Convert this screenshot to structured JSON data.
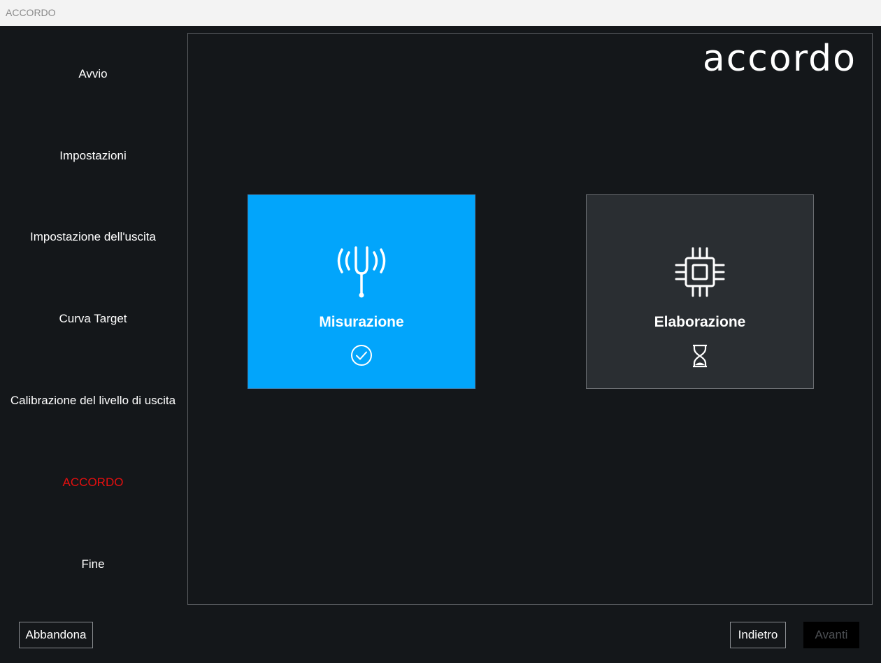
{
  "window": {
    "title": "ACCORDO"
  },
  "sidebar": {
    "items": [
      {
        "label": "Avvio"
      },
      {
        "label": "Impostazioni"
      },
      {
        "label": "Impostazione dell'uscita"
      },
      {
        "label": "Curva Target"
      },
      {
        "label": "Calibrazione del livello di uscita"
      },
      {
        "label": "ACCORDO",
        "current": true
      },
      {
        "label": "Fine"
      }
    ]
  },
  "main": {
    "logo": "accordo",
    "tiles": [
      {
        "label": "Misurazione",
        "icon": "tuning-fork-icon",
        "status_icon": "check-circle-icon",
        "state": "complete"
      },
      {
        "label": "Elaborazione",
        "icon": "processor-chip-icon",
        "status_icon": "hourglass-icon",
        "state": "in-progress"
      }
    ]
  },
  "footer": {
    "abandon_label": "Abbandona",
    "back_label": "Indietro",
    "next_label": "Avanti"
  },
  "colors": {
    "background": "#14171a",
    "active_tile": "#02a5fb",
    "pending_tile": "#2a2e32",
    "current_step": "#e60f0f"
  }
}
